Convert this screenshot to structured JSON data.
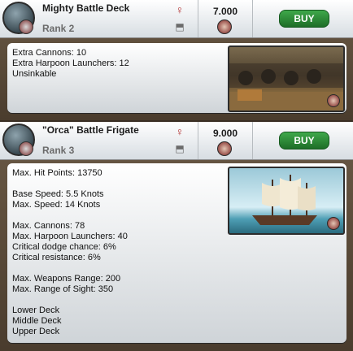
{
  "items": [
    {
      "title": "Mighty Battle Deck",
      "rank": "Rank 2",
      "price": "7.000",
      "buy_label": "BUY",
      "details": [
        "Extra Cannons: 10",
        "Extra Harpoon Launchers: 12",
        "Unsinkable"
      ]
    },
    {
      "title": "\"Orca\" Battle Frigate",
      "rank": "Rank 3",
      "price": "9.000",
      "buy_label": "BUY",
      "details": [
        "Max. Hit Points: 13750",
        "",
        "Base Speed: 5.5 Knots",
        "Max. Speed: 14 Knots",
        "",
        "Max. Cannons: 78",
        "Max. Harpoon Launchers: 40",
        "Critical dodge chance: 6%",
        "Critical resistance: 6%",
        "",
        "Max. Weapons Range: 200",
        "Max. Range of Sight: 350",
        "",
        "Lower Deck",
        "Middle Deck",
        "Upper Deck"
      ]
    }
  ],
  "colors": {
    "buy_green": "#2a8f36",
    "header_bg": "#eef1f3",
    "frame_brown": "#5a4a38"
  },
  "icons": [
    "ship-badge-icon",
    "wishlist-icon",
    "compare-icon",
    "coin-icon"
  ]
}
